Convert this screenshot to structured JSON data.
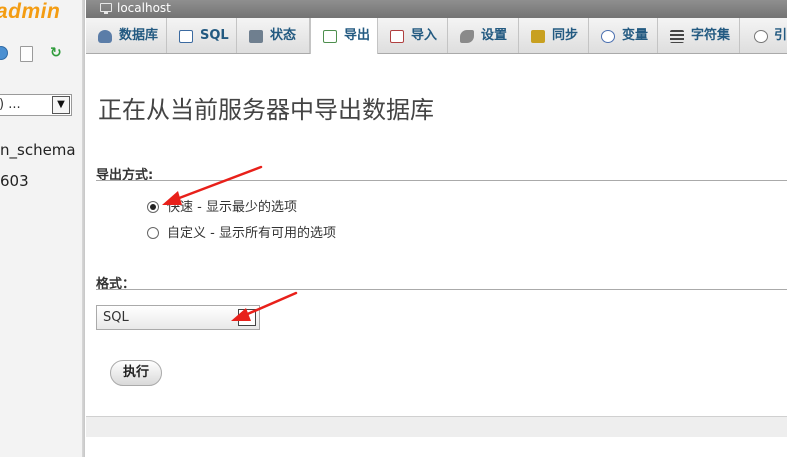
{
  "sidebar": {
    "logo": "admin",
    "db_select_value": ") ...",
    "items": [
      "n_schema",
      "603"
    ]
  },
  "topbar": {
    "server": "localhost"
  },
  "tabs": [
    {
      "label": "数据库",
      "icon": "database-icon",
      "color": "#5b7da8"
    },
    {
      "label": "SQL",
      "icon": "sql-icon",
      "color": "#3b6aa0"
    },
    {
      "label": "状态",
      "icon": "status-icon",
      "color": "#6f7f8f"
    },
    {
      "label": "导出",
      "icon": "export-icon",
      "color": "#4e8f4e"
    },
    {
      "label": "导入",
      "icon": "import-icon",
      "color": "#b04040"
    },
    {
      "label": "设置",
      "icon": "wrench-icon",
      "color": "#7a7a7a"
    },
    {
      "label": "同步",
      "icon": "sync-icon",
      "color": "#c8a020"
    },
    {
      "label": "变量",
      "icon": "variables-icon",
      "color": "#4a6fb0"
    },
    {
      "label": "字符集",
      "icon": "charset-icon",
      "color": "#444444"
    },
    {
      "label": "引",
      "icon": "engines-icon",
      "color": "#777777"
    }
  ],
  "main": {
    "title": "正在从当前服务器中导出数据库",
    "export_method_label": "导出方式:",
    "options": [
      {
        "label": "快速 - 显示最少的选项",
        "checked": true
      },
      {
        "label": "自定义 - 显示所有可用的选项",
        "checked": false
      }
    ],
    "format_label": "格式：",
    "format_value": "SQL",
    "go_button": "执行"
  },
  "colors": {
    "annotation_arrow": "#e8201a",
    "tab_text": "#235a81",
    "logo": "#f39c12"
  }
}
